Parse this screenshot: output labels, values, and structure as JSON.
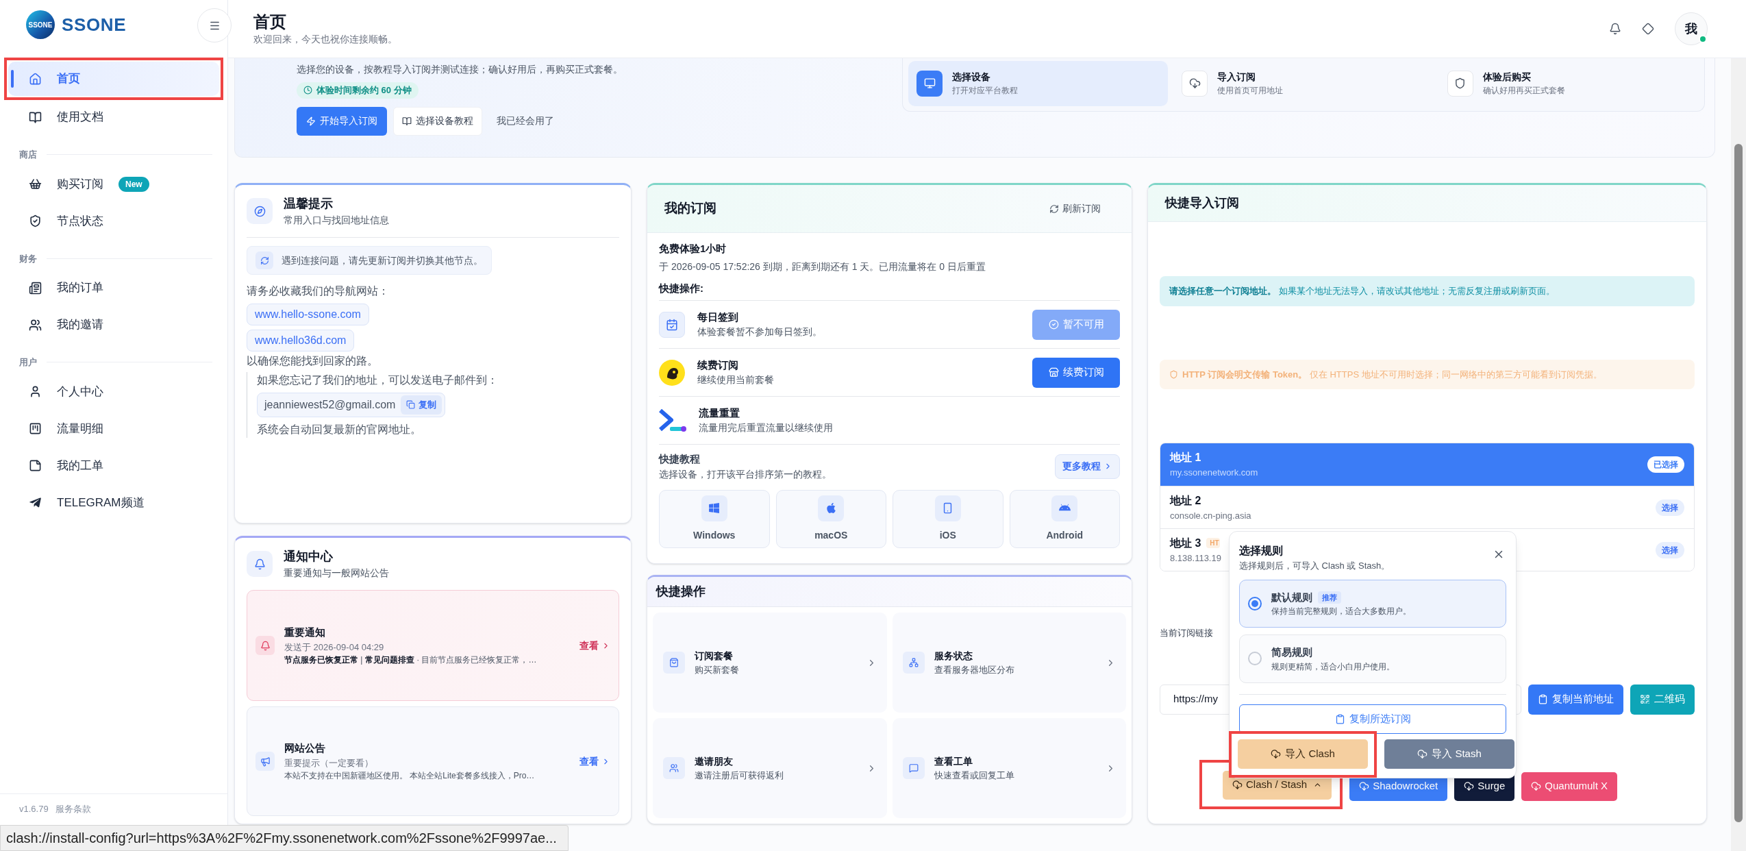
{
  "brand": {
    "name": "SSONE",
    "logo_text": "SSONE"
  },
  "sidebar": {
    "sections": [
      {
        "items": [
          {
            "label": "首页",
            "selected": true,
            "annotated": true
          },
          {
            "label": "使用文档",
            "selected": false,
            "annotated": false
          }
        ]
      },
      {
        "title": "商店",
        "items": [
          {
            "label": "购买订阅",
            "badge": "New",
            "selected": false,
            "annotated": false
          },
          {
            "label": "节点状态",
            "selected": false,
            "annotated": false
          }
        ]
      },
      {
        "title": "财务",
        "items": [
          {
            "label": "我的订单",
            "selected": false,
            "annotated": false
          },
          {
            "label": "我的邀请",
            "selected": false,
            "annotated": false
          }
        ]
      },
      {
        "title": "用户",
        "items": [
          {
            "label": "个人中心",
            "selected": false,
            "annotated": false
          },
          {
            "label": "流量明细",
            "selected": false,
            "annotated": false
          },
          {
            "label": "我的工单",
            "selected": false,
            "annotated": false
          },
          {
            "label": "TELEGRAM频道",
            "selected": false,
            "annotated": false
          }
        ]
      }
    ],
    "footer": {
      "version": "v1.6.79",
      "terms": "服务条款"
    }
  },
  "header": {
    "title": "首页",
    "subtitle": "欢迎回来，今天也祝你连接顺畅。",
    "avatar": "我"
  },
  "banner": {
    "description": "选择您的设备，按教程导入订阅并测试连接；确认好用后，再购买正式套餐。",
    "badge": "体验时间剩余约 60 分钟",
    "buttons": [
      "开始导入订阅",
      "选择设备教程",
      "我已经会用了"
    ],
    "steps": [
      {
        "title": "选择设备",
        "subtitle": "打开对应平台教程",
        "selected": true
      },
      {
        "title": "导入订阅",
        "subtitle": "使用首页可用地址",
        "selected": false
      },
      {
        "title": "体验后购买",
        "subtitle": "确认好用再买正式套餐",
        "selected": false
      }
    ]
  },
  "tips": {
    "title": "温馨提示",
    "subtitle": "常用入口与找回地址信息",
    "notice": "遇到连接问题，请先更新订阅并切换其他节点。",
    "intro": "请务必收藏我们的导航网站：",
    "links": [
      "www.hello-ssone.com",
      "www.hello36d.com"
    ],
    "outro": "以确保您能找到回家的路。",
    "email_intro": "如果您忘记了我们的地址，可以发送电子邮件到：",
    "email": "jeanniewest52@gmail.com",
    "copy": "复制",
    "email_outro": "系统会自动回复最新的官网地址。"
  },
  "notifications": {
    "title": "通知中心",
    "subtitle": "重要通知与一般网站公告",
    "items": [
      {
        "kind": "important",
        "title": "重要通知",
        "meta": "发送于 2026-09-04 04:29",
        "summary": "**节点服务已恢复正常** | **常见问题排查** · 目前节点服务已经恢复正常，…",
        "action": "查看"
      },
      {
        "kind": "general",
        "title": "网站公告",
        "meta": "重要提示（一定要看）",
        "summary": "本站不支持在中国新疆地区使用。 本站全站Lite套餐多线接入，Pro…",
        "action": "查看"
      }
    ]
  },
  "subscription": {
    "title": "我的订阅",
    "refresh": "刷新订阅",
    "plan": "免费体验1小时",
    "detail": "于 2026-09-05 17:52:26 到期，距离到期还有 1 天。已用流量将在 0 日后重置",
    "quick_title": "快捷操作:",
    "actions": [
      {
        "title": "每日签到",
        "subtitle": "体验套餐暂不参加每日签到。",
        "button": "暂不可用",
        "disabled": true
      },
      {
        "title": "续费订阅",
        "subtitle": "继续使用当前套餐",
        "button": "续费订阅",
        "disabled": false
      },
      {
        "title": "流量重置",
        "subtitle": "流量用完后重置流量以继续使用"
      }
    ],
    "tutorial": {
      "title": "快捷教程",
      "subtitle": "选择设备，打开该平台排序第一的教程。",
      "more": "更多教程",
      "platforms": [
        "Windows",
        "macOS",
        "iOS",
        "Android"
      ]
    }
  },
  "quick_ops": {
    "title": "快捷操作",
    "items": [
      {
        "title": "订阅套餐",
        "subtitle": "购买新套餐"
      },
      {
        "title": "服务状态",
        "subtitle": "查看服务器地区分布"
      },
      {
        "title": "邀请朋友",
        "subtitle": "邀请注册后可获得返利"
      },
      {
        "title": "查看工单",
        "subtitle": "快速查看或回复工单"
      }
    ]
  },
  "import": {
    "title": "快捷导入订阅",
    "info": "**请选择任意一个订阅地址。** 如果某个地址无法导入，请改试其他地址；无需反复注册或刷新页面。",
    "warning": "**HTTP 订阅会明文传输 Token。** 仅在 HTTPS 地址不可用时选择；同一网络中的第三方可能看到订阅凭据。",
    "addresses": [
      {
        "name": "地址 1",
        "host": "my.ssonenetwork.com",
        "action": "已选择",
        "selected": true
      },
      {
        "name": "地址 2",
        "host": "console.cn-ping.asia",
        "action": "选择",
        "selected": false
      },
      {
        "name": "地址 3",
        "tag": "HT",
        "host": "8.138.113.19",
        "action": "选择",
        "selected": false
      }
    ],
    "link_label": "当前订阅链接",
    "link_value": "https://my",
    "copy_button": "复制当前地址",
    "qr_button": "二维码",
    "clients": [
      {
        "label": "Clash / Stash",
        "color": "#f5cfa0",
        "expanded": true,
        "annotated": true
      },
      {
        "label": "Shadowrocket",
        "color": "#3b7cf6",
        "annotated": false
      },
      {
        "label": "Surge",
        "color": "#111c3a",
        "annotated": false
      },
      {
        "label": "Quantumult X",
        "color": "#ec4d73",
        "annotated": false
      }
    ],
    "popover": {
      "title": "选择规则",
      "subtitle": "选择规则后，可导入 Clash 或 Stash。",
      "options": [
        {
          "title": "默认规则",
          "badge": "推荐",
          "description": "保持当前完整规则，适合大多数用户。",
          "selected": true
        },
        {
          "title": "简易规则",
          "description": "规则更精简，适合小白用户使用。",
          "selected": false
        }
      ],
      "copy": "复制所选订阅",
      "imports": [
        {
          "label": "导入 Clash",
          "color": "#f5cfa0",
          "annotated": true
        },
        {
          "label": "导入 Stash",
          "color": "#6f7f98",
          "annotated": false
        }
      ]
    }
  },
  "status_bar": "clash://install-config?url=https%3A%2F%2Fmy.ssonenetwork.com%2Fssone%2F9997ae..."
}
